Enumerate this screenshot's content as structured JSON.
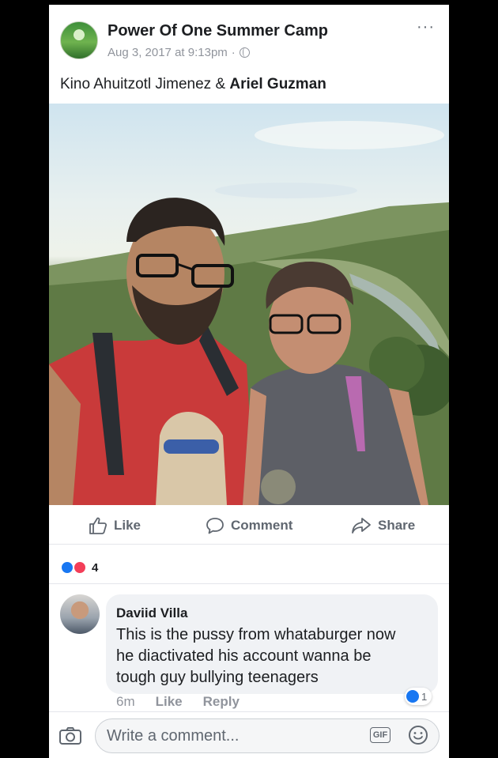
{
  "post": {
    "page_name": "Power Of One Summer Camp",
    "timestamp": "Aug 3, 2017 at 9:13pm",
    "separator": "·",
    "more": "···",
    "caption_first": "Kino Ahuitzotl Jimenez",
    "caption_joiner": " & ",
    "caption_second": "Ariel Guzman"
  },
  "actions": {
    "like_label": "Like",
    "comment_label": "Comment",
    "share_label": "Share"
  },
  "reactions": {
    "count": "4"
  },
  "comment": {
    "author": "Daviid Villa",
    "lines": [
      "This is the pussy from whataburger now",
      "he diactivated his account wanna be",
      "tough guy bullying teenagers"
    ],
    "time": "6m",
    "like_label": "Like",
    "reply_label": "Reply",
    "reaction_count": "1"
  },
  "composer": {
    "placeholder": "Write a comment...",
    "gif_label": "GIF"
  },
  "colors": {
    "facebook_blue": "#1877f2",
    "love_red": "#f33e58",
    "meta_gray": "#90949c"
  }
}
